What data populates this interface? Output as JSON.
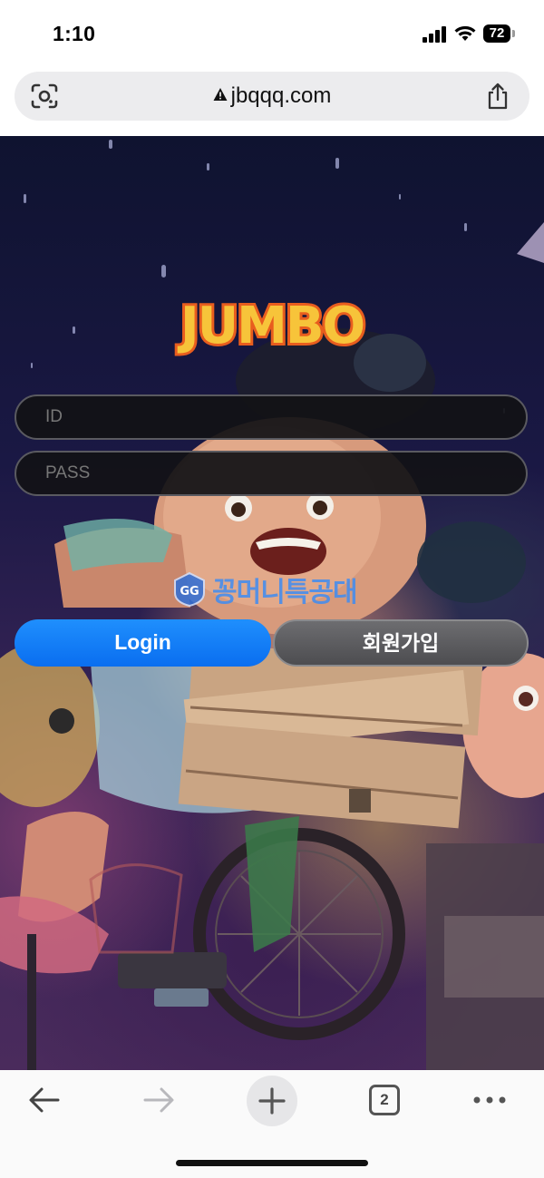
{
  "status_bar": {
    "time": "1:10",
    "battery": "72"
  },
  "browser": {
    "url": "jbqqq.com",
    "tab_count": "2",
    "icons": [
      "lens-icon",
      "warning-icon",
      "share-icon",
      "back-icon",
      "forward-icon",
      "plus-icon",
      "tabs-icon",
      "more-icon"
    ]
  },
  "page": {
    "logo_text": "JUMBO",
    "id_placeholder": "ID",
    "pass_placeholder": "PASS",
    "watermark": "꽁머니특공대",
    "login_label": "Login",
    "join_label": "회원가입"
  },
  "colors": {
    "login_button": "#0a6ef0",
    "join_button": "#5a5a5d",
    "logo_fill": "#f7c43a",
    "logo_outline": "#e85d1e"
  }
}
